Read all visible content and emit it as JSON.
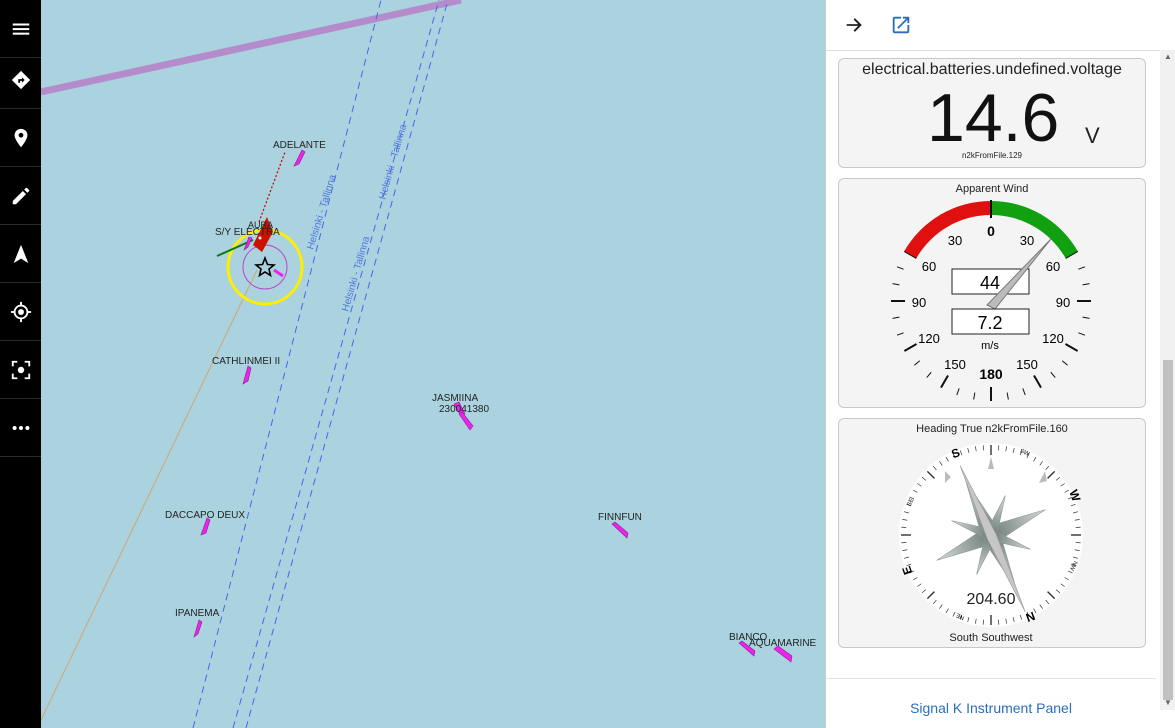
{
  "toolbar": {
    "items": [
      {
        "name": "menu-icon"
      },
      {
        "name": "route-icon"
      },
      {
        "name": "waypoint-icon"
      },
      {
        "name": "edit-icon"
      },
      {
        "name": "navigate-icon"
      },
      {
        "name": "locate-icon"
      },
      {
        "name": "focus-icon"
      },
      {
        "name": "more-icon"
      }
    ]
  },
  "map": {
    "vessels": [
      {
        "label": "ADELANTE"
      },
      {
        "label": "S/Y ELECTRA"
      },
      {
        "label": "AURA"
      },
      {
        "label": "CATHLINMEI II"
      },
      {
        "label": "JASMIINA"
      },
      {
        "label": "230041380"
      },
      {
        "label": "DACCAPO DEUX"
      },
      {
        "label": "FINNFUN"
      },
      {
        "label": "IPANEMA"
      },
      {
        "label": "BIANCO"
      },
      {
        "label": "AQUAMARINE"
      }
    ],
    "route_labels": [
      "Helsinki - Tallinna",
      "Helsinki - Tallinna",
      "Helsinki - Tallinna"
    ]
  },
  "panel": {
    "voltage": {
      "title": "electrical.batteries.undefined.voltage",
      "value": "14.6",
      "unit": "V",
      "source": "n2kFromFile.129"
    },
    "wind": {
      "title": "Apparent Wind",
      "angle": "44",
      "speed": "7.2",
      "unit": "m/s",
      "tick_labels": [
        "0",
        "30",
        "30",
        "60",
        "60",
        "90",
        "90",
        "120",
        "120",
        "150",
        "150",
        "180"
      ]
    },
    "heading": {
      "title": "Heading True n2kFromFile.160",
      "value": "204.60",
      "direction": "South Southwest",
      "letters": [
        "S",
        "W",
        "N",
        "E",
        "SW",
        "NW",
        "NE",
        "SE"
      ]
    },
    "footer_link": "Signal K Instrument Panel"
  },
  "colors": {
    "accent": "#2a6ebb",
    "port": "#dd1100",
    "starboard": "#119911",
    "vessel": "#ee22ee"
  }
}
